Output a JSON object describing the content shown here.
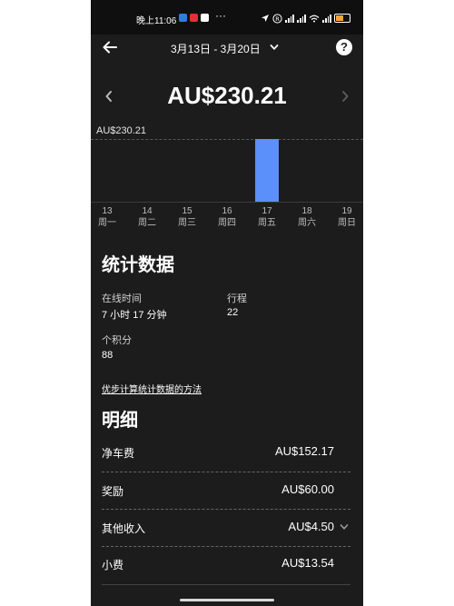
{
  "status_bar": {
    "time": "晚上11:06",
    "more": "···",
    "battery": "20"
  },
  "header": {
    "date_range": "3月13日 - 3月20日"
  },
  "summary": {
    "total": "AU$230.21"
  },
  "chart_data": {
    "type": "bar",
    "title": "",
    "categories": [
      "13 周一",
      "14 周二",
      "15 周三",
      "16 周四",
      "17 周五",
      "18 周六",
      "19 周日"
    ],
    "values": [
      0,
      0,
      0,
      0,
      230.21,
      0,
      0
    ],
    "max_line_label": "AU$230.21",
    "ylim": [
      0,
      230.21
    ],
    "days": [
      {
        "num": "13",
        "weekday": "周一"
      },
      {
        "num": "14",
        "weekday": "周二"
      },
      {
        "num": "15",
        "weekday": "周三"
      },
      {
        "num": "16",
        "weekday": "周四"
      },
      {
        "num": "17",
        "weekday": "周五"
      },
      {
        "num": "18",
        "weekday": "周六"
      },
      {
        "num": "19",
        "weekday": "周日"
      }
    ],
    "bar_color": "#5b8ff9"
  },
  "stats": {
    "heading": "统计数据",
    "online_time_label": "在线时间",
    "online_time_value": "7 小时 17 分钟",
    "trips_label": "行程",
    "trips_value": "22",
    "points_label": "个积分",
    "points_value": "88",
    "method_link": "优步计算统计数据的方法"
  },
  "details": {
    "heading": "明细",
    "items": [
      {
        "label": "净车费",
        "amount": "AU$152.17"
      },
      {
        "label": "奖励",
        "amount": "AU$60.00"
      },
      {
        "label": "其他收入",
        "amount": "AU$4.50"
      },
      {
        "label": "小费",
        "amount": "AU$13.54"
      }
    ]
  },
  "colors": {
    "background": "#1c1c1c",
    "accent": "#5b8ff9"
  }
}
